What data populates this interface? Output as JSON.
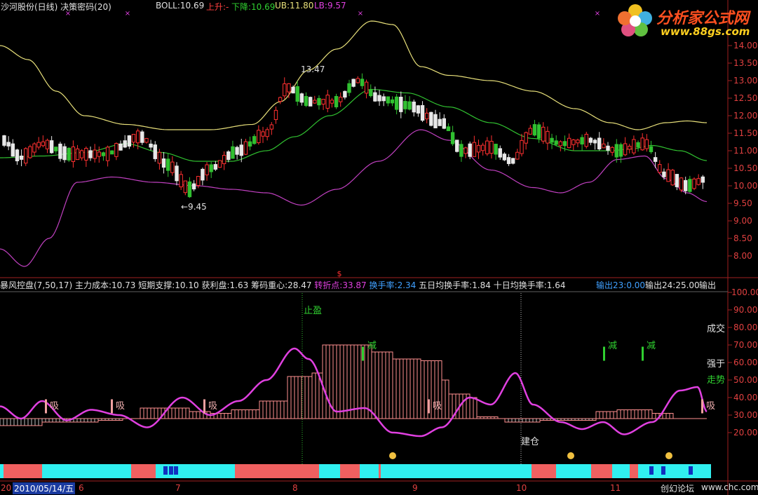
{
  "header": {
    "title": "沙河股份(日线) 决策密码(20)",
    "boll_label": "BOLL:10.69",
    "up_label": "上升:-",
    "down_label": "下降:10.69",
    "ub_label": "UB:11.80",
    "lb_label": "LB:9.57"
  },
  "logo": {
    "name": "分析家公式网",
    "url": "www.88gs.com"
  },
  "price_axis": {
    "ticks": [
      "14.00",
      "13.50",
      "13.00",
      "12.50",
      "12.00",
      "11.50",
      "11.00",
      "10.50",
      "10.00",
      "9.50",
      "9.00",
      "8.50",
      "8.00"
    ]
  },
  "annotations": {
    "high": "13.47",
    "low": "←9.45"
  },
  "indicator_header": {
    "name": "暴风控盘(7,50,17)",
    "cost": "主力成本:10.73",
    "support": "短期支撑:10.10",
    "profit": "获利盘:1.63",
    "chip": "筹码重心:28.47",
    "turn": "转折点:33.87",
    "turnover": "换手率:2.34",
    "t5": "五日均换手率:1.84",
    "t10": "十日均换手率:1.64",
    "out1": "输出23:0.00",
    "out2": "输出24:25.00",
    "out3": "输出"
  },
  "indicator_axis": {
    "ticks": [
      "100.00",
      "90.00",
      "80.00",
      "70.00",
      "60.00",
      "50.00",
      "40.00",
      "30.00",
      "20.00"
    ]
  },
  "right_labels": {
    "l1": "成交",
    "l2": "强于",
    "l3": "走势"
  },
  "signals": {
    "take_profit": "止盈",
    "build": "建仓",
    "absorb": "吸",
    "reduce": "减"
  },
  "date_axis": {
    "start": "20",
    "current": "2010/05/14/五",
    "months": [
      "6",
      "7",
      "8",
      "9",
      "10",
      "11"
    ]
  },
  "footer": {
    "forum": "创幻论坛",
    "site": "www.chc.com"
  },
  "colors": {
    "boll_upper": "#e8e07a",
    "boll_mid": "#30c030",
    "boll_lower": "#c040c0",
    "up_candle": "#ff3030",
    "down_candle": "#30c030",
    "indicator_line": "#e040e0",
    "fill": "#ff9090",
    "strip_cyan": "#30f0f0",
    "strip_red": "#f06060"
  },
  "chart_data": {
    "type": "line",
    "title": "沙河股份(日线)",
    "series": [
      {
        "name": "UB",
        "values": [
          11.8
        ]
      },
      {
        "name": "BOLL",
        "values": [
          10.69
        ]
      },
      {
        "name": "LB",
        "values": [
          9.57
        ]
      }
    ],
    "ylim": [
      7.8,
      14.2
    ],
    "high_marker": 13.47,
    "low_marker": 9.45,
    "indicator_ylim": [
      10,
      105
    ]
  }
}
